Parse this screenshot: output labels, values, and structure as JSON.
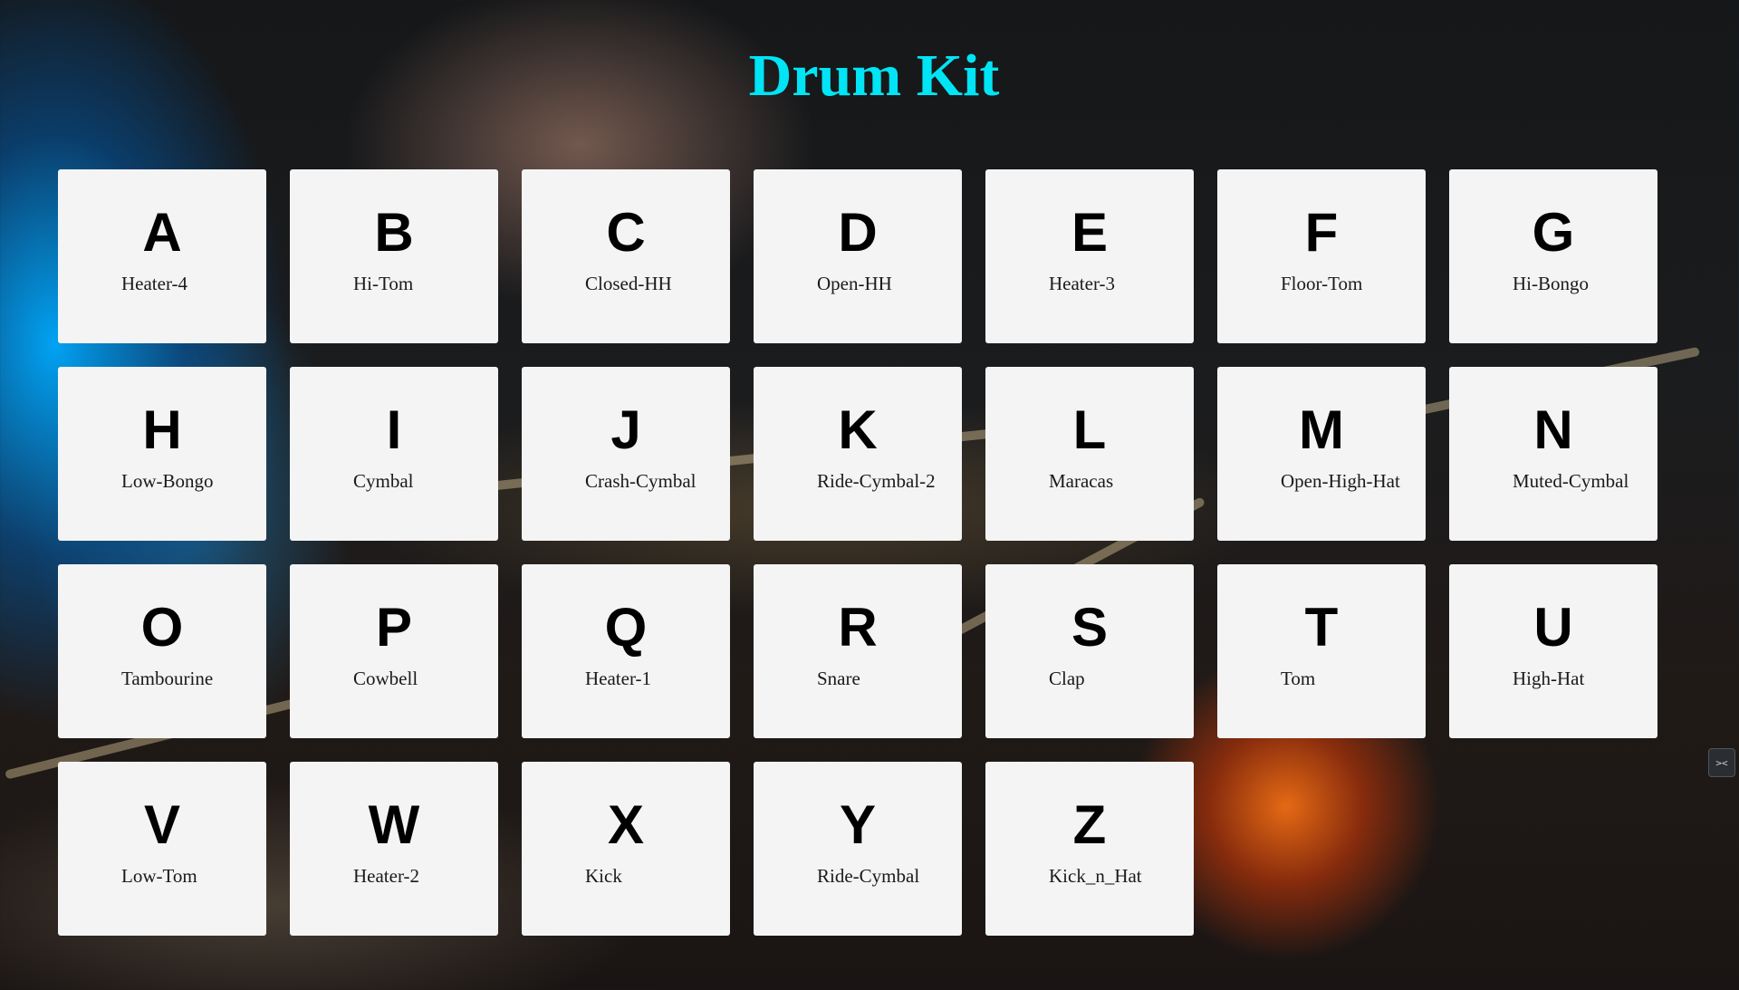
{
  "page": {
    "title": "Drum Kit"
  },
  "pads": [
    {
      "key": "A",
      "sound": "Heater-4"
    },
    {
      "key": "B",
      "sound": "Hi-Tom"
    },
    {
      "key": "C",
      "sound": "Closed-HH"
    },
    {
      "key": "D",
      "sound": "Open-HH"
    },
    {
      "key": "E",
      "sound": "Heater-3"
    },
    {
      "key": "F",
      "sound": "Floor-Tom"
    },
    {
      "key": "G",
      "sound": "Hi-Bongo"
    },
    {
      "key": "H",
      "sound": "Low-Bongo"
    },
    {
      "key": "I",
      "sound": "Cymbal"
    },
    {
      "key": "J",
      "sound": "Crash-Cymbal"
    },
    {
      "key": "K",
      "sound": "Ride-Cymbal-2"
    },
    {
      "key": "L",
      "sound": "Maracas"
    },
    {
      "key": "M",
      "sound": "Open-High-Hat"
    },
    {
      "key": "N",
      "sound": "Muted-Cymbal"
    },
    {
      "key": "O",
      "sound": "Tambourine"
    },
    {
      "key": "P",
      "sound": "Cowbell"
    },
    {
      "key": "Q",
      "sound": "Heater-1"
    },
    {
      "key": "R",
      "sound": "Snare"
    },
    {
      "key": "S",
      "sound": "Clap"
    },
    {
      "key": "T",
      "sound": "Tom"
    },
    {
      "key": "U",
      "sound": "High-Hat"
    },
    {
      "key": "V",
      "sound": "Low-Tom"
    },
    {
      "key": "W",
      "sound": "Heater-2"
    },
    {
      "key": "X",
      "sound": "Kick"
    },
    {
      "key": "Y",
      "sound": "Ride-Cymbal"
    },
    {
      "key": "Z",
      "sound": "Kick_n_Hat"
    }
  ],
  "side_handle": {
    "icon": "collapse-arrows-icon",
    "glyph": "><"
  },
  "colors": {
    "title": "#00e5f5",
    "pad_background": "#f4f4f5",
    "key_text": "#000000"
  }
}
